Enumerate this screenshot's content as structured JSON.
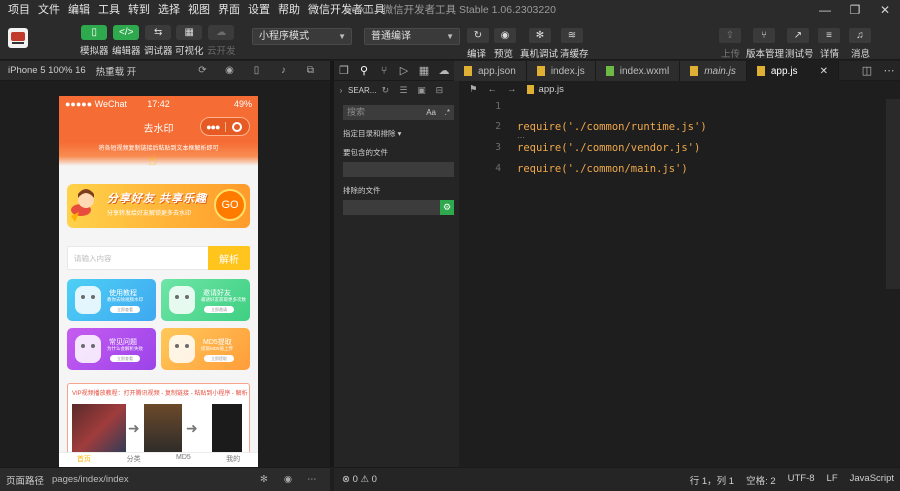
{
  "menu": [
    "项目",
    "文件",
    "编辑",
    "工具",
    "转到",
    "选择",
    "视图",
    "界面",
    "设置",
    "帮助",
    "微信开发者工具"
  ],
  "window_title": "weixin - 微信开发者工具 Stable 1.06.2303220",
  "window_controls": {
    "minimize": "—",
    "restore": "❐",
    "close": "✕"
  },
  "toolbar": {
    "simulator": "模拟器",
    "editor": "编辑器",
    "debugger": "调试器",
    "visual": "可视化",
    "cloud": "云开发",
    "mode_select": "小程序模式",
    "compile_select": "普通编译",
    "compile": "编译",
    "preview": "预览",
    "device_debug": "真机调试",
    "clear_cache": "清缓存",
    "upload": "上传",
    "version_mgmt": "版本管理",
    "test_account": "测试号",
    "details": "详情",
    "messages": "消息"
  },
  "simulator": {
    "device": "iPhone 5 100% 16",
    "hot_reload": "热重载 开",
    "footer_label": "页面路径",
    "page_path": "pages/index/index"
  },
  "phone": {
    "carrier": "●●●●● WeChat",
    "time": "17:42",
    "battery": "49%",
    "nav_title": "去水印",
    "notice": "将各短视频复制链接后粘贴到文本框解析即可",
    "banner_title": "分享好友  共享乐趣",
    "banner_sub": "分享转发给好友解锁更多去水印",
    "banner_go": "GO",
    "search_placeholder": "请输入内容",
    "parse_button": "解析",
    "cards": [
      {
        "title": "使用教程",
        "sub": "教你去除视频水印",
        "btn": "立即查看",
        "color_from": "#4dd0f5",
        "color_to": "#3fa8f0"
      },
      {
        "title": "邀请好友",
        "sub": "邀请好友获取更多次数",
        "btn": "立即邀请",
        "color_from": "#6ee5a7",
        "color_to": "#3fcf82"
      },
      {
        "title": "常见问题",
        "sub": "为什么会解析失败",
        "btn": "立即查看",
        "color_from": "#c65cf0",
        "color_to": "#9b44ea"
      },
      {
        "title": "MD5提取",
        "sub": "提取MD5值上传",
        "btn": "立即提取",
        "color_from": "#ffc85a",
        "color_to": "#ff9d3a"
      }
    ],
    "vip_title": "VIP视频播放教程：打开腾讯视频 - 复制链接 - 粘贴到小程序 - 解析",
    "tabs": [
      "首页",
      "分类",
      "MD5",
      "我的"
    ]
  },
  "editor": {
    "search_title": "SEAR...",
    "search_placeholder": "搜索",
    "match_case": "Aa",
    "regex": ".*",
    "scope_label": "指定目录和排除 ▾",
    "include_label": "要包含的文件",
    "exclude_label": "排除的文件",
    "tabs": [
      {
        "name": "app.json",
        "color": "#e0b034",
        "italic": false,
        "active": false
      },
      {
        "name": "index.js",
        "color": "#e0b034",
        "italic": false,
        "active": false
      },
      {
        "name": "index.wxml",
        "color": "#6dbb45",
        "italic": false,
        "active": false
      },
      {
        "name": "main.js",
        "color": "#e0b034",
        "italic": true,
        "active": false
      },
      {
        "name": "app.js",
        "color": "#e0b034",
        "italic": false,
        "active": true
      }
    ],
    "breadcrumb": "app.js",
    "lines": [
      {
        "num": "1",
        "text": ""
      },
      {
        "num": "2",
        "text": "require('./common/runtime.js')"
      },
      {
        "num": "3",
        "text": "require('./common/vendor.js')"
      },
      {
        "num": "4",
        "text": "require('./common/main.js')"
      }
    ],
    "ellipsis": "···"
  },
  "status": {
    "problems": "⊗ 0 ⚠ 0",
    "position": "行 1，列 1",
    "spaces": "空格: 2",
    "encoding": "UTF-8",
    "eol": "LF",
    "language": "JavaScript"
  }
}
